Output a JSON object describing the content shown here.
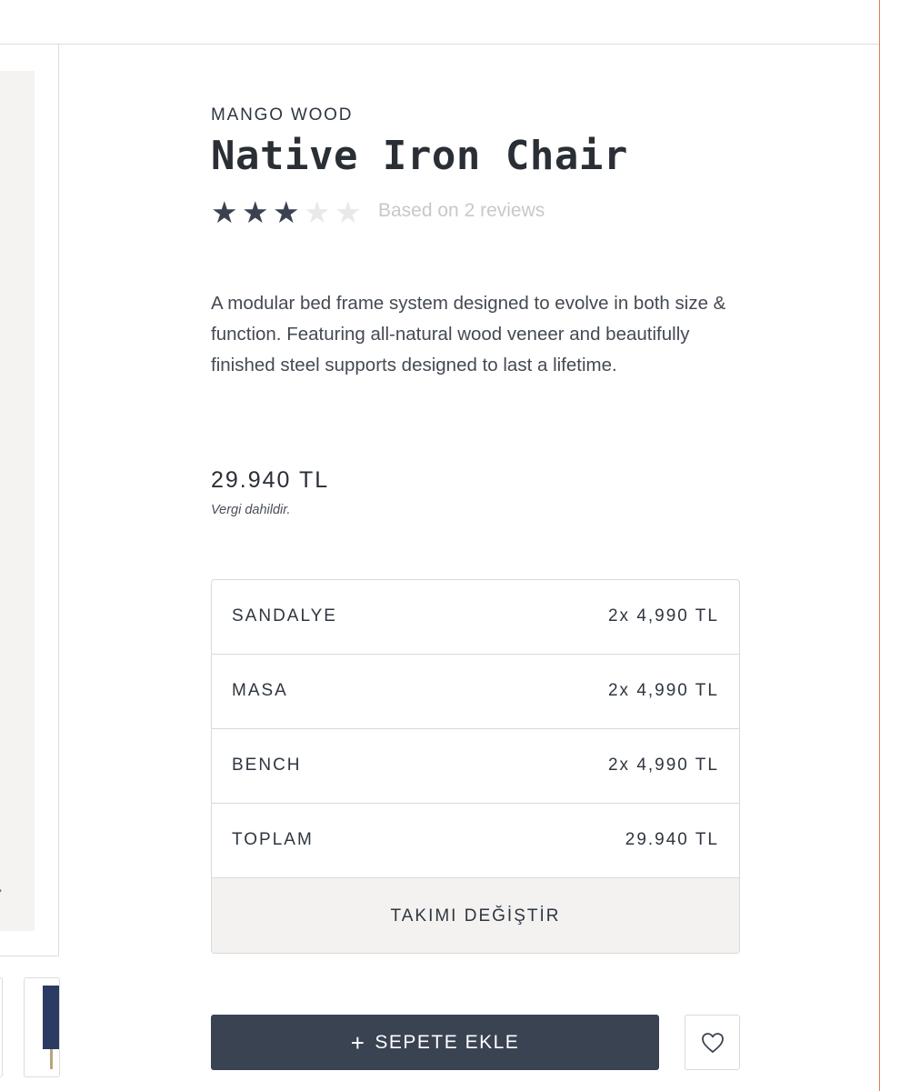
{
  "product": {
    "brand": "MANGO WOOD",
    "title": "Native Iron Chair",
    "rating": {
      "value": 3,
      "max": 5,
      "reviews_label": "Based on 2 reviews"
    },
    "description": "A modular bed frame system designed to evolve in both size & function. Featuring all-natural wood veneer and beautifully finished steel supports designed to last a lifetime.",
    "price": "29.940 TL",
    "tax_note": "Vergi dahildir."
  },
  "set_table": {
    "rows": [
      {
        "name": "SANDALYE",
        "value": "2x 4,990 TL"
      },
      {
        "name": "MASA",
        "value": "2x 4,990 TL"
      },
      {
        "name": "BENCH",
        "value": "2x 4,990  TL"
      },
      {
        "name": "TOPLAM",
        "value": "29.940  TL"
      }
    ],
    "change_label": "TAKIMI DEĞİŞTİR"
  },
  "actions": {
    "add_to_cart_icon": "+",
    "add_to_cart_label": "SEPETE EKLE",
    "wishlist_icon": "heart-icon"
  },
  "gallery": {
    "arrow_icon": "chevron-right-icon",
    "arrow_glyph": "›"
  },
  "colors": {
    "primary_button": "#3a4352",
    "star_filled": "#3a4252",
    "star_empty": "#e9e9ec",
    "accent_edge": "#e97a4f"
  }
}
